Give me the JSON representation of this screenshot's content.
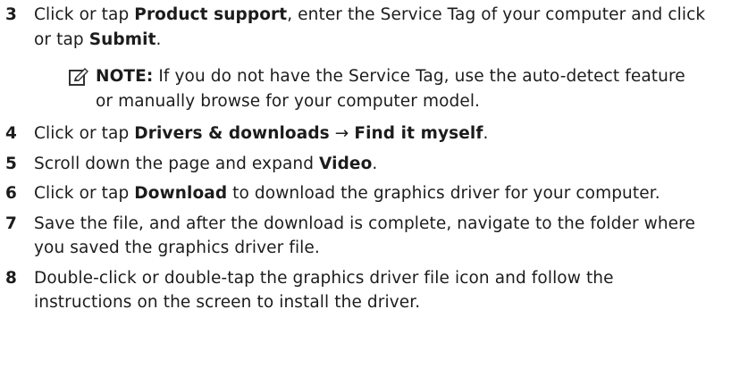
{
  "steps": [
    {
      "number": "3",
      "parts": [
        "Click or tap ",
        "Product support",
        ", enter the Service Tag of your computer and click or tap ",
        "Submit",
        "."
      ]
    },
    {
      "number": "4",
      "parts": [
        "Click or tap ",
        "Drivers & downloads",
        " → ",
        "Find it myself",
        "."
      ]
    },
    {
      "number": "5",
      "parts": [
        "Scroll down the page and expand ",
        "Video",
        "."
      ]
    },
    {
      "number": "6",
      "parts": [
        "Click or tap ",
        "Download",
        " to download the graphics driver for your computer."
      ]
    },
    {
      "number": "7",
      "text": "Save the file, and after the download is complete, navigate to the folder where you saved the graphics driver file."
    },
    {
      "number": "8",
      "text": "Double-click or double-tap the graphics driver file icon and follow the instructions on the screen to install the driver."
    }
  ],
  "note": {
    "icon": "pencil-note-icon",
    "label": "NOTE:",
    "text": " If you do not have the Service Tag, use the auto-detect feature or manually browse for your computer model."
  }
}
